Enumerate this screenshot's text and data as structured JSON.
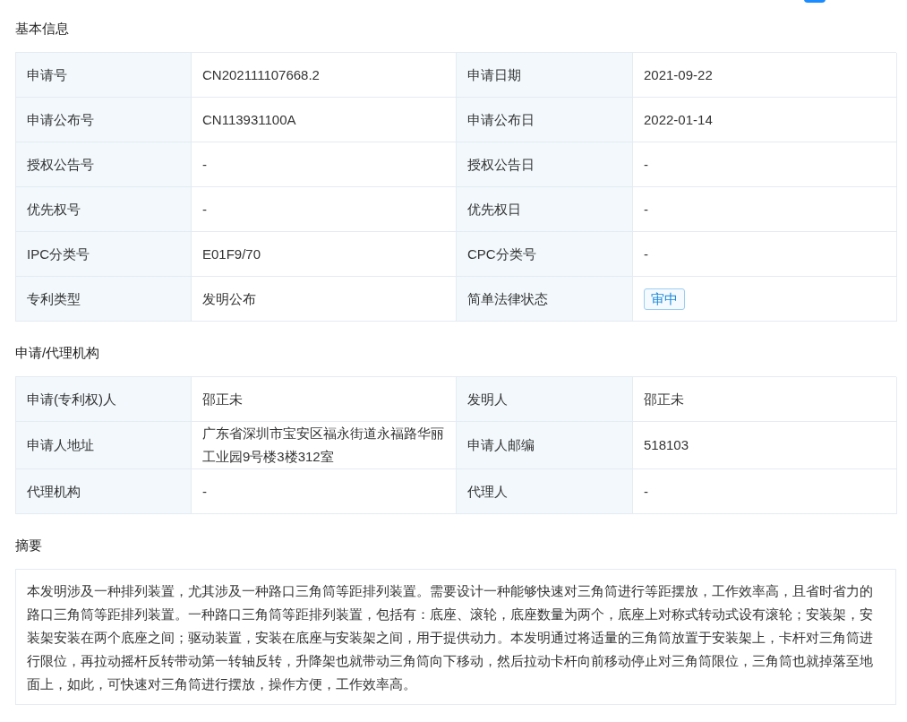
{
  "sections": [
    {
      "kind": "table",
      "title": "基本信息",
      "rows": [
        {
          "cells": [
            {
              "label": "申请号",
              "value": "CN202111107668.2",
              "kind": "text"
            },
            {
              "label": "申请日期",
              "value": "2021-09-22",
              "kind": "text"
            }
          ]
        },
        {
          "cells": [
            {
              "label": "申请公布号",
              "value": "CN113931100A",
              "kind": "text"
            },
            {
              "label": "申请公布日",
              "value": "2022-01-14",
              "kind": "text"
            }
          ]
        },
        {
          "cells": [
            {
              "label": "授权公告号",
              "value": "-",
              "kind": "text"
            },
            {
              "label": "授权公告日",
              "value": "-",
              "kind": "text"
            }
          ]
        },
        {
          "cells": [
            {
              "label": "优先权号",
              "value": "-",
              "kind": "text"
            },
            {
              "label": "优先权日",
              "value": "-",
              "kind": "text"
            }
          ]
        },
        {
          "cells": [
            {
              "label": "IPC分类号",
              "value": "E01F9/70",
              "kind": "text"
            },
            {
              "label": "CPC分类号",
              "value": "-",
              "kind": "text"
            }
          ]
        },
        {
          "cells": [
            {
              "label": "专利类型",
              "value": "发明公布",
              "kind": "text"
            },
            {
              "label": "简单法律状态",
              "value": "审中",
              "kind": "tag"
            }
          ]
        }
      ]
    },
    {
      "kind": "table",
      "title": "申请/代理机构",
      "rows": [
        {
          "cells": [
            {
              "label": "申请(专利权)人",
              "value": "邵正未",
              "kind": "text"
            },
            {
              "label": "发明人",
              "value": "邵正未",
              "kind": "text"
            }
          ]
        },
        {
          "cells": [
            {
              "label": "申请人地址",
              "value": "广东省深圳市宝安区福永街道永福路华丽工业园9号楼3楼312室",
              "kind": "text"
            },
            {
              "label": "申请人邮编",
              "value": "518103",
              "kind": "text"
            }
          ]
        },
        {
          "cells": [
            {
              "label": "代理机构",
              "value": "-",
              "kind": "text"
            },
            {
              "label": "代理人",
              "value": "-",
              "kind": "text"
            }
          ]
        }
      ]
    },
    {
      "kind": "text",
      "title": "摘要",
      "text": "本发明涉及一种排列装置，尤其涉及一种路口三角筒等距排列装置。需要设计一种能够快速对三角筒进行等距摆放，工作效率高，且省时省力的路口三角筒等距排列装置。一种路口三角筒等距排列装置，包括有：底座、滚轮，底座数量为两个，底座上对称式转动式设有滚轮；安装架，安装架安装在两个底座之间；驱动装置，安装在底座与安装架之间，用于提供动力。本发明通过将适量的三角筒放置于安装架上，卡杆对三角筒进行限位，再拉动摇杆反转带动第一转轴反转，升降架也就带动三角筒向下移动，然后拉动卡杆向前移动停止对三角筒限位，三角筒也就掉落至地面上，如此，可快速对三角筒进行摆放，操作方便，工作效率高。"
    }
  ]
}
